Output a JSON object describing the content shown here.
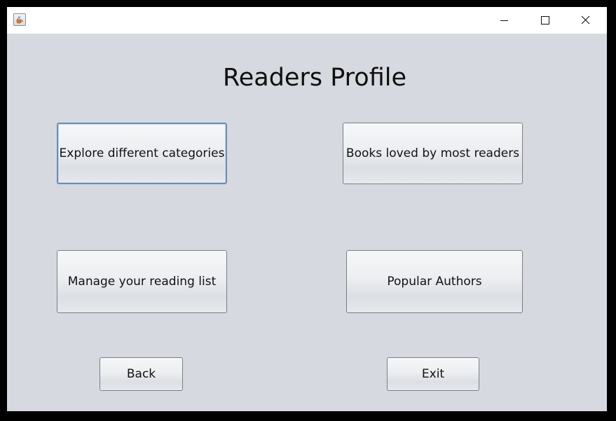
{
  "window": {
    "title": "",
    "controls": {
      "minimize_icon": "minimize-icon",
      "maximize_icon": "maximize-icon",
      "close_icon": "close-icon"
    }
  },
  "page": {
    "title": "Readers Profile"
  },
  "buttons": {
    "explore_categories": "Explore different categories",
    "books_loved": "Books loved by most readers",
    "manage_reading_list": "Manage your reading list",
    "popular_authors": "Popular Authors",
    "back": "Back",
    "exit": "Exit"
  },
  "colors": {
    "window_background": "#d6d9df",
    "titlebar_background": "#ffffff",
    "focus_border": "#6b8db5"
  }
}
